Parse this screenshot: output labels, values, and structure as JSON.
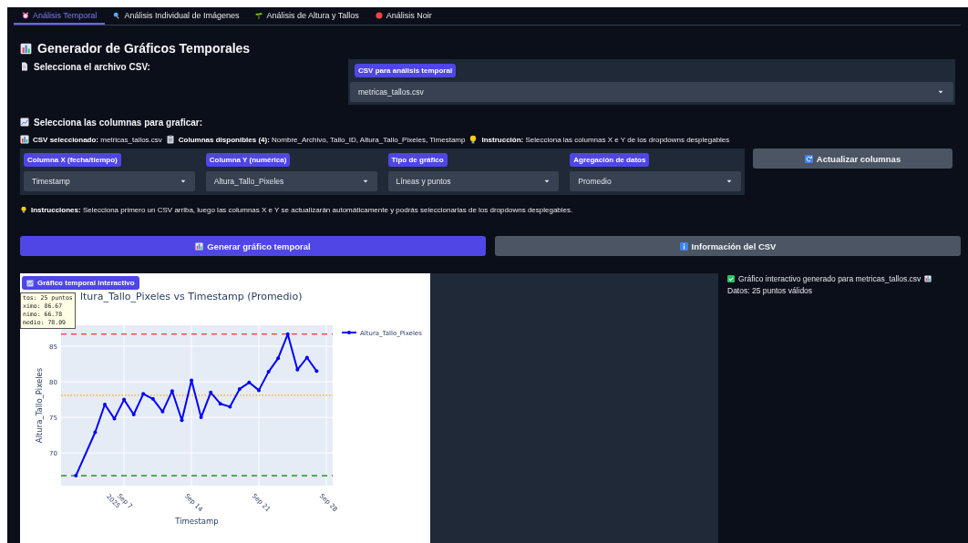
{
  "tabs": [
    {
      "label": "Análisis Temporal",
      "selected": true
    },
    {
      "label": "Análisis Individual de Imágenes",
      "selected": false
    },
    {
      "label": "Análisis de Altura y Tallos",
      "selected": false
    },
    {
      "label": "Análisis Noir",
      "selected": false
    }
  ],
  "title": "Generador de Gráficos Temporales",
  "file_heading": "Selecciona el archivo CSV:",
  "csv_select": {
    "label": "CSV para análisis temporal",
    "value": "metricas_tallos.csv"
  },
  "columns_heading": "Selecciona las columnas para graficar:",
  "info_line": [
    "**CSV seleccionado:** metricas_tallos.csv",
    "**Columnas disponibles (4):** Nombre_Archivo, Tallo_ID, Altura_Tallo_Pixeles, Timestamp",
    "**Instrucción:** Selecciona las columnas X e Y de los dropdowns desplegables"
  ],
  "dropdowns": [
    {
      "label": "Columna X (fecha/tiempo)",
      "value": "Timestamp"
    },
    {
      "label": "Columna Y (numérica)",
      "value": "Altura_Tallo_Pixeles"
    },
    {
      "label": "Tipo de gráfico",
      "value": "Líneas y puntos"
    },
    {
      "label": "Agregación de datos",
      "value": "Promedio"
    }
  ],
  "refresh_button": "Actualizar columnas",
  "instructions": "**Instrucciones:** Selecciona primero un CSV arriba, luego las columnas X e Y se actualizarán automáticamente y podrás seleccionarlas de los dropdowns desplegables.",
  "buttons": [
    {
      "label": "Generar gráfico temporal",
      "kind": "primary"
    },
    {
      "label": "Información del CSV",
      "kind": "secondary"
    }
  ],
  "chart_panel": {
    "badge": "Gráfico temporal interactivo",
    "stats_tooltip": [
      "tos: 25 puntos",
      "ximo: 86.67",
      "nimo: 66.78",
      "medio: 78.09"
    ],
    "chart_data": {
      "type": "line",
      "title": "ltura_Tallo_Pixeles vs Timestamp (Promedio)",
      "xlabel": "Timestamp",
      "ylabel": "Altura_Tallo_Pixeles",
      "x": [
        "2025-09-02",
        "2025-09-04",
        "2025-09-05",
        "2025-09-06",
        "2025-09-07",
        "2025-09-08",
        "2025-09-09",
        "2025-09-10",
        "2025-09-11",
        "2025-09-12",
        "2025-09-13",
        "2025-09-14",
        "2025-09-15",
        "2025-09-16",
        "2025-09-17",
        "2025-09-18",
        "2025-09-19",
        "2025-09-20",
        "2025-09-21",
        "2025-09-22",
        "2025-09-23",
        "2025-09-24",
        "2025-09-25",
        "2025-09-26",
        "2025-09-27"
      ],
      "series": [
        {
          "name": "Altura_Tallo_Pixeles",
          "color": "#0000ff",
          "values": [
            66.8,
            72.9,
            76.8,
            74.8,
            77.5,
            75.4,
            78.3,
            77.6,
            75.8,
            78.7,
            74.6,
            80.2,
            75.0,
            78.5,
            76.9,
            76.5,
            79.0,
            79.9,
            78.8,
            81.4,
            83.3,
            86.7,
            81.7,
            83.4,
            81.5
          ]
        }
      ],
      "xlim": [
        "2025-08-31T11:00",
        "2025-09-28T16:00"
      ],
      "ylim": [
        65.4,
        87.95
      ],
      "xticks": [
        {
          "value": "2025-09-07",
          "label": "Sep 7\n2025"
        },
        {
          "value": "2025-09-14",
          "label": "Sep 14"
        },
        {
          "value": "2025-09-21",
          "label": "Sep 21"
        },
        {
          "value": "2025-09-28",
          "label": "Sep 28"
        }
      ],
      "yticks": [
        70,
        75,
        80,
        85
      ],
      "grid": true,
      "ref_lines": [
        {
          "axis": "y",
          "value": 86.7,
          "color": "#ff0000"
        },
        {
          "axis": "y",
          "value": 78.1,
          "color": "#ffa500"
        },
        {
          "axis": "y",
          "value": 66.8,
          "color": "#008000"
        }
      ]
    }
  },
  "result": [
    "Gráfico interactivo generado para metricas_tallos.csv",
    "Datos: 25 puntos válidos"
  ]
}
